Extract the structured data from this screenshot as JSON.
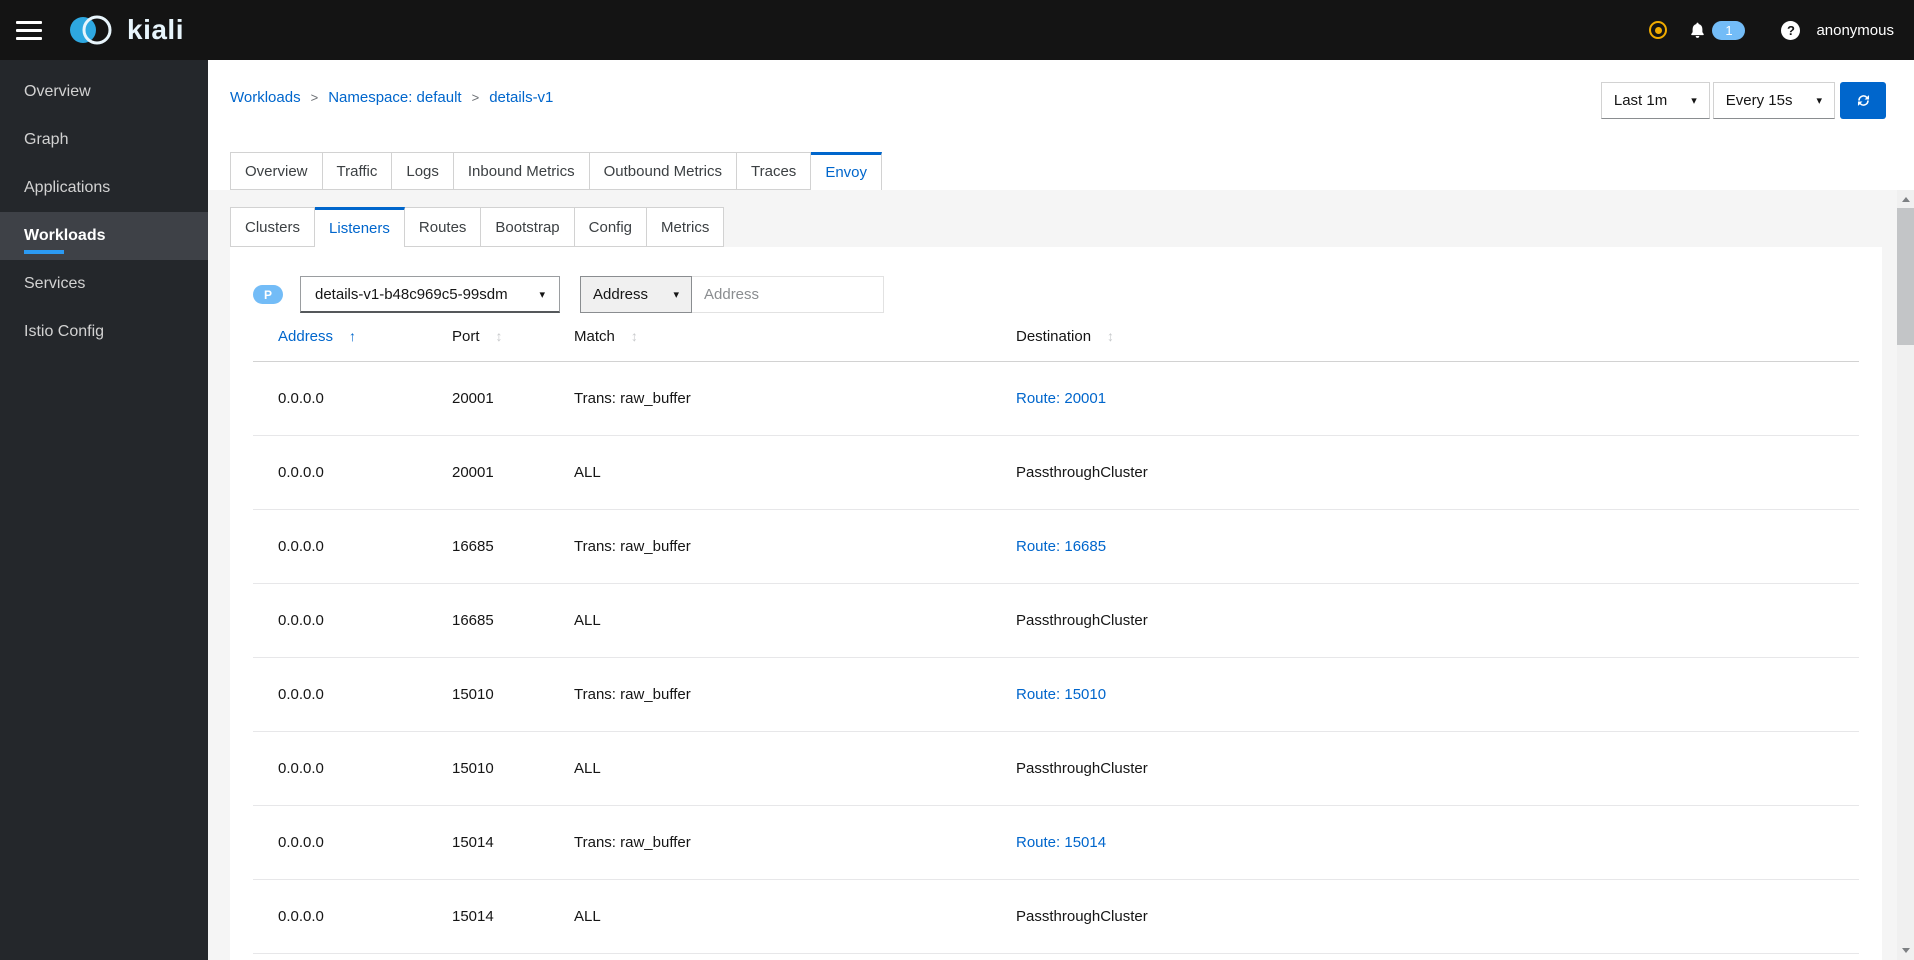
{
  "masthead": {
    "brand": "kiali",
    "notification_count": "1",
    "user": "anonymous"
  },
  "sidebar": {
    "items": [
      {
        "label": "Overview",
        "active": false
      },
      {
        "label": "Graph",
        "active": false
      },
      {
        "label": "Applications",
        "active": false
      },
      {
        "label": "Workloads",
        "active": true
      },
      {
        "label": "Services",
        "active": false
      },
      {
        "label": "Istio Config",
        "active": false
      }
    ]
  },
  "breadcrumb": {
    "items": [
      "Workloads",
      "Namespace: default",
      "details-v1"
    ]
  },
  "toolbar": {
    "duration_label": "Last 1m",
    "refresh_label": "Every 15s"
  },
  "main_tabs": {
    "labels": [
      "Overview",
      "Traffic",
      "Logs",
      "Inbound Metrics",
      "Outbound Metrics",
      "Traces",
      "Envoy"
    ],
    "active": "Envoy"
  },
  "envoy_tabs": {
    "labels": [
      "Clusters",
      "Listeners",
      "Routes",
      "Bootstrap",
      "Config",
      "Metrics"
    ],
    "active": "Listeners"
  },
  "filters": {
    "pod_badge": "P",
    "pod_selected": "details-v1-b48c969c5-99sdm",
    "filter_type": "Address",
    "filter_placeholder": "Address",
    "filter_value": ""
  },
  "table": {
    "columns": [
      {
        "label": "Address",
        "sort": "asc"
      },
      {
        "label": "Port",
        "sort": null
      },
      {
        "label": "Match",
        "sort": null
      },
      {
        "label": "Destination",
        "sort": null
      }
    ],
    "rows": [
      {
        "address": "0.0.0.0",
        "port": "20001",
        "match": "Trans: raw_buffer",
        "destination": "Route: 20001",
        "destination_link": true
      },
      {
        "address": "0.0.0.0",
        "port": "20001",
        "match": "ALL",
        "destination": "PassthroughCluster",
        "destination_link": false
      },
      {
        "address": "0.0.0.0",
        "port": "16685",
        "match": "Trans: raw_buffer",
        "destination": "Route: 16685",
        "destination_link": true
      },
      {
        "address": "0.0.0.0",
        "port": "16685",
        "match": "ALL",
        "destination": "PassthroughCluster",
        "destination_link": false
      },
      {
        "address": "0.0.0.0",
        "port": "15010",
        "match": "Trans: raw_buffer",
        "destination": "Route: 15010",
        "destination_link": true
      },
      {
        "address": "0.0.0.0",
        "port": "15010",
        "match": "ALL",
        "destination": "PassthroughCluster",
        "destination_link": false
      },
      {
        "address": "0.0.0.0",
        "port": "15014",
        "match": "Trans: raw_buffer",
        "destination": "Route: 15014",
        "destination_link": true
      },
      {
        "address": "0.0.0.0",
        "port": "15014",
        "match": "ALL",
        "destination": "PassthroughCluster",
        "destination_link": false
      }
    ]
  },
  "icons": {
    "caret_down": "▾",
    "sort_asc": "↑",
    "sort_none": "↕",
    "breadcrumb_separator": ">"
  },
  "colors": {
    "primary_blue": "#0066cc",
    "nav_accent_blue": "#2b9af3",
    "badge_blue": "#73bcf7",
    "warning_gold": "#f0ab00",
    "masthead_bg": "#141414",
    "sidebar_bg": "#24272b",
    "sidebar_active_bg": "#3e4147",
    "content_gray": "#f5f5f5"
  }
}
